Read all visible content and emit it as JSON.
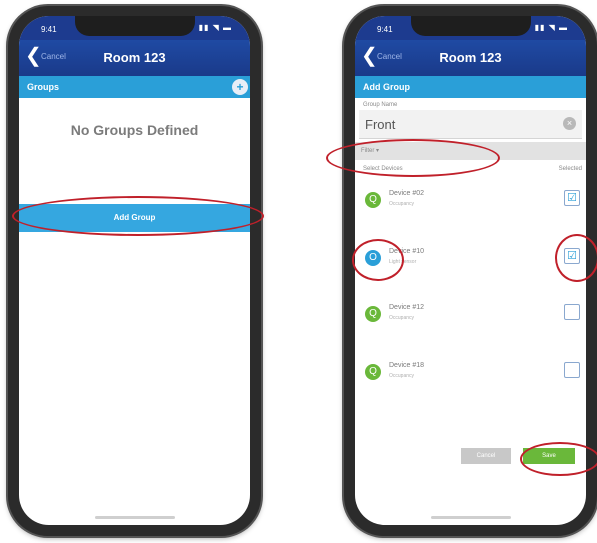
{
  "left_phone": {
    "status": {
      "time": "9:41",
      "icons": "▮▮ ◥ ▬"
    },
    "nav": {
      "back_glyph": "❮",
      "cancel_label": "Cancel",
      "title": "Room 123"
    },
    "section": {
      "title": "Groups",
      "add_glyph": "+"
    },
    "empty_message": "No Groups Defined",
    "add_group_button": "Add Group"
  },
  "right_phone": {
    "status": {
      "time": "9:41",
      "icons": "▮▮ ◥ ▬"
    },
    "nav": {
      "back_glyph": "❮",
      "cancel_label": "Cancel",
      "title": "Room 123"
    },
    "section": {
      "title": "Add Group"
    },
    "name_label": "Group Name",
    "name_value": "Front",
    "clear_glyph": "×",
    "filter_label": "Filter ▾",
    "column_select_devices": "Select Devices",
    "column_selected": "Selected",
    "devices": [
      {
        "name": "Device #02",
        "sub": "Occupancy",
        "icon": "Q",
        "icon_color": "#6ab83a",
        "checked": "☑"
      },
      {
        "name": "Device #10",
        "sub": "Light sensor",
        "icon": "O",
        "icon_color": "#2a9fd8",
        "checked": "☑"
      },
      {
        "name": "Device #12",
        "sub": "Occupancy",
        "icon": "Q",
        "icon_color": "#6ab83a",
        "checked": ""
      },
      {
        "name": "Device #18",
        "sub": "Occupancy",
        "icon": "Q",
        "icon_color": "#6ab83a",
        "checked": ""
      }
    ],
    "cancel_button": "Cancel",
    "save_button": "Save"
  },
  "colors": {
    "nav": "#1f4aa3",
    "section": "#2a9fd8",
    "highlight_ring": "#c0202a",
    "save": "#6ab83a"
  }
}
